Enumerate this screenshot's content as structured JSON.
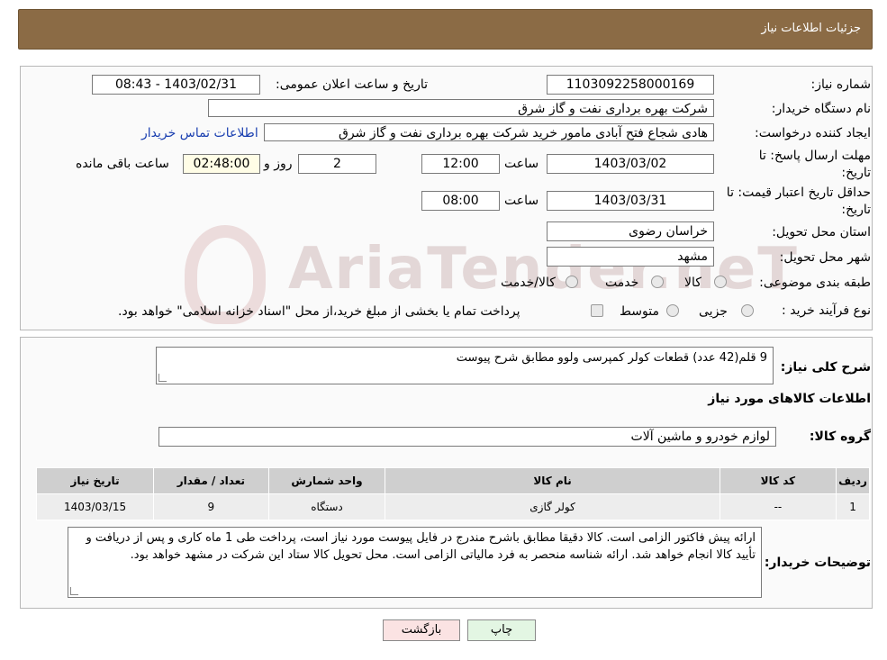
{
  "header": {
    "title": "جزئیات اطلاعات نیاز"
  },
  "fields": {
    "need_number_label": "شماره نیاز:",
    "need_number": "1103092258000169",
    "announce_label": "تاریخ و ساعت اعلان عمومی:",
    "announce_value": "1403/02/31 - 08:43",
    "buyer_org_label": "نام دستگاه خریدار:",
    "buyer_org": "شرکت بهره برداری نفت و گاز شرق",
    "creator_label": "ایجاد کننده درخواست:",
    "creator": "هادی شجاع فتح آبادی مامور خرید شرکت بهره برداری نفت و گاز شرق",
    "contact_link": "اطلاعات تماس خریدار",
    "send_deadline_label": "مهلت ارسال پاسخ: تا تاریخ:",
    "send_deadline_date": "1403/03/02",
    "time_label": "ساعت",
    "send_deadline_time": "12:00",
    "days_value": "2",
    "days_label": "روز و",
    "remaining_value": "02:48:00",
    "remaining_label": "ساعت باقی مانده",
    "validity_label": "حداقل تاریخ اعتبار قیمت: تا تاریخ:",
    "validity_date": "1403/03/31",
    "validity_time": "08:00",
    "province_label": "استان محل تحویل:",
    "province": "خراسان رضوی",
    "city_label": "شهر محل تحویل:",
    "city": "مشهد",
    "category_label": "طبقه بندی موضوعی:",
    "category_options": [
      "کالا",
      "خدمت",
      "کالا/خدمت"
    ],
    "process_label": "نوع فرآیند خرید :",
    "process_options": [
      "جزیی",
      "متوسط"
    ],
    "process_note": "پرداخت تمام یا بخشی از مبلغ خرید،از محل \"اسناد خزانه اسلامی\" خواهد بود."
  },
  "description": {
    "label": "شرح کلی نیاز:",
    "text": "9 قلم(42 عدد) قطعات کولر  کمپرسی ولوو مطابق شرح پیوست"
  },
  "goods_info": {
    "title": "اطلاعات کالاهای مورد نیاز",
    "group_label": "گروه کالا:",
    "group_value": "لوازم خودرو و ماشین آلات"
  },
  "table": {
    "headers": [
      "ردیف",
      "کد کالا",
      "نام کالا",
      "واحد شمارش",
      "تعداد / مقدار",
      "تاریخ نیاز"
    ],
    "rows": [
      [
        "1",
        "--",
        "کولر گازی",
        "دستگاه",
        "9",
        "1403/03/15"
      ]
    ]
  },
  "buyer_notes": {
    "label": "توضیحات خریدار:",
    "text": "ارائه پیش فاکتور الزامی است. کالا دقیقا مطابق باشرح مندرج در فایل پیوست مورد نیاز است، پرداخت طی  1 ماه کاری و پس از دریافت و تأیید کالا انجام خواهد شد. ارائه شناسه منحصر به فرد مالیاتی الزامی است. محل تحویل کالا ستاد این شرکت در مشهد خواهد بود."
  },
  "buttons": {
    "print": "چاپ",
    "back": "بازگشت"
  },
  "watermark": {
    "text": "AriaTender.neT"
  },
  "colors": {
    "header_bg": "#8b6b45",
    "link": "#1a3fb0",
    "back_btn_bg": "#fbe3e3",
    "print_btn_bg": "#e3f6e3"
  }
}
